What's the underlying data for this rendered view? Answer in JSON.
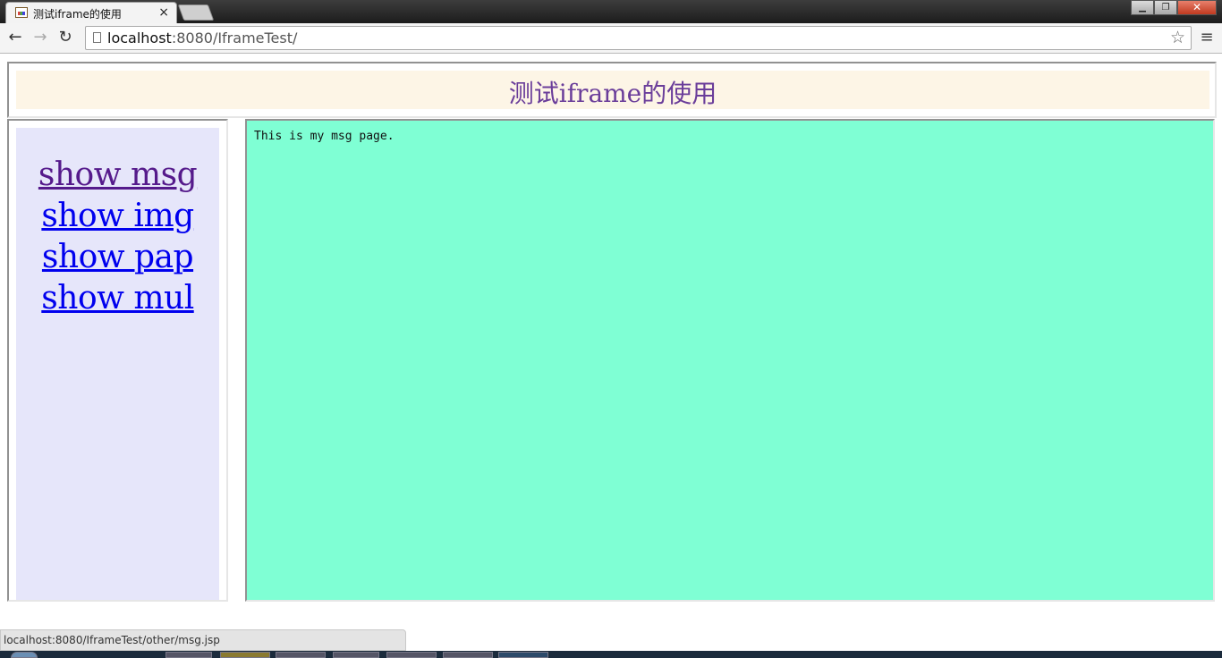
{
  "browser": {
    "tab_title": "测试iframe的使用",
    "tab_close": "×",
    "url_host": "localhost",
    "url_rest": ":8080/IframeTest/",
    "star": "☆",
    "menu": "≡",
    "back": "←",
    "forward": "→",
    "reload": "↻",
    "minimize": "▁",
    "restore": "❐",
    "close": "✕"
  },
  "page": {
    "header_title": "测试iframe的使用",
    "nav_links": [
      "show msg",
      "show img",
      "show pap",
      "show mul"
    ],
    "content_text": "This is my msg page."
  },
  "status": {
    "hover_url": "localhost:8080/IframeTest/other/msg.jsp"
  },
  "colors": {
    "header_bg": "#fdf5e6",
    "header_text": "#6a3d9a",
    "nav_bg": "#e6e6fa",
    "content_bg": "#7fffd4",
    "link_visited": "#551a8b",
    "link_unvisited": "#0000ee"
  }
}
